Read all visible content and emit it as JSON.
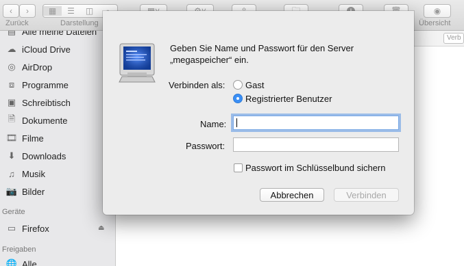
{
  "toolbar": {
    "back_label": "Zurück",
    "view_label": "Darstellung",
    "overview_label": "Übersicht"
  },
  "sidebar": {
    "items": [
      {
        "label": "Alle meine Dateien",
        "icon": "all-files-icon"
      },
      {
        "label": "iCloud Drive",
        "icon": "cloud-icon"
      },
      {
        "label": "AirDrop",
        "icon": "airdrop-icon"
      },
      {
        "label": "Programme",
        "icon": "applications-icon"
      },
      {
        "label": "Schreibtisch",
        "icon": "desktop-icon"
      },
      {
        "label": "Dokumente",
        "icon": "document-icon"
      },
      {
        "label": "Filme",
        "icon": "film-icon"
      },
      {
        "label": "Downloads",
        "icon": "download-icon"
      },
      {
        "label": "Musik",
        "icon": "music-icon"
      },
      {
        "label": "Bilder",
        "icon": "camera-icon"
      }
    ],
    "devices_header": "Geräte",
    "devices": [
      {
        "label": "Firefox",
        "icon": "drive-icon"
      }
    ],
    "shares_header": "Freigaben",
    "shares": [
      {
        "label": "Alle",
        "icon": "network-icon"
      }
    ]
  },
  "main": {
    "column_button": "Verb"
  },
  "dialog": {
    "message_line1": "Geben Sie Name und Passwort für den Server",
    "message_line2": "„megaspeicher“ ein.",
    "connect_as_label": "Verbinden als:",
    "radio_guest": "Gast",
    "radio_registered": "Registrierter Benutzer",
    "selected": "Registrierter Benutzer",
    "name_label": "Name:",
    "name_value": "",
    "password_label": "Passwort:",
    "password_value": "",
    "keychain_label": "Passwort im Schlüsselbund sichern",
    "keychain_checked": false,
    "cancel_button": "Abbrechen",
    "connect_button": "Verbinden",
    "accent_color": "#3b8ff5"
  }
}
